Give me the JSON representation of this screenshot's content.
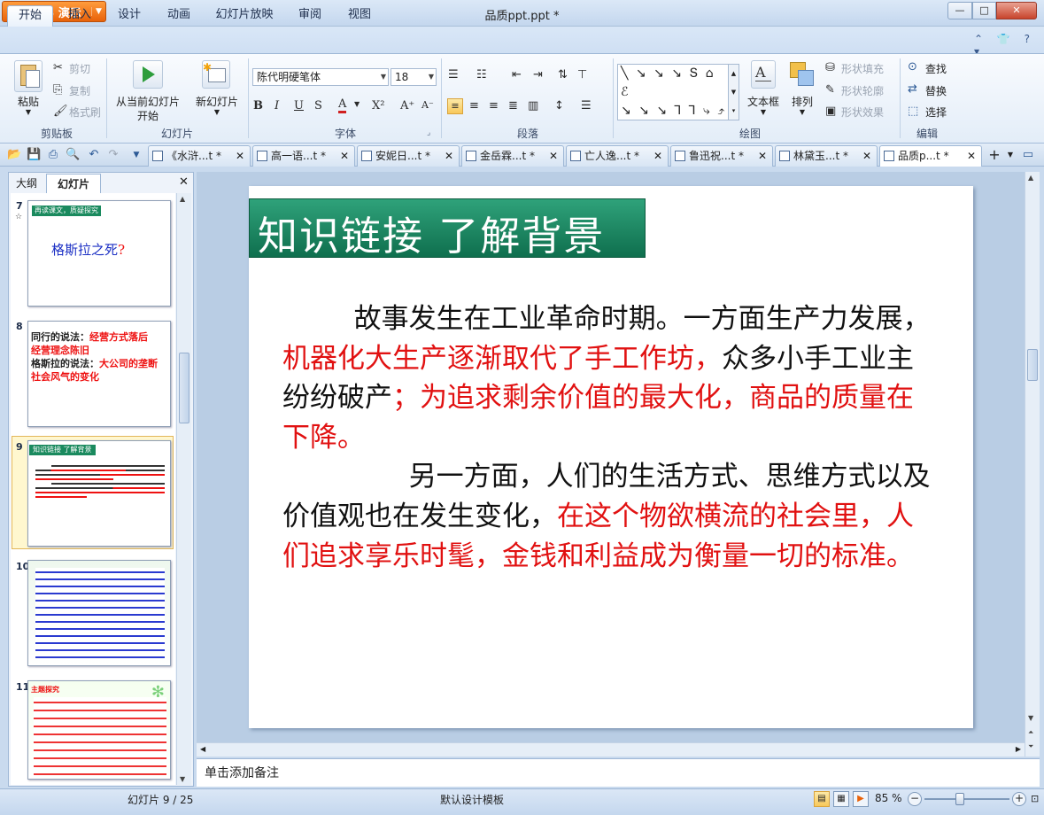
{
  "window": {
    "app_button": "WPS 演示",
    "doc_title": "品质ppt.ppt *",
    "controls": {
      "minimize": "—",
      "maximize": "□",
      "close": "✕"
    }
  },
  "menu": {
    "tabs": [
      "开始",
      "插入",
      "设计",
      "动画",
      "幻灯片放映",
      "审阅",
      "视图"
    ],
    "right_icons": "⌃ 👕 ? ▾"
  },
  "ribbon": {
    "clipboard": {
      "label": "剪贴板",
      "paste": "粘贴",
      "cut": "剪切",
      "copy": "复制",
      "format_painter": "格式刷"
    },
    "slides": {
      "label": "幻灯片",
      "from_current": "从当前幻灯片",
      "from_current_2": "开始",
      "new_slide": "新幻灯片"
    },
    "font": {
      "label": "字体",
      "font_name": "陈代明硬笔体",
      "font_size": "18",
      "bold": "B",
      "italic": "I",
      "underline": "U",
      "shadow": "S",
      "color": "A",
      "superscript": "X²",
      "grow": "A⁺",
      "shrink": "A⁻"
    },
    "paragraph": {
      "label": "段落"
    },
    "drawing": {
      "label": "绘图",
      "textbox": "文本框",
      "arrange": "排列",
      "shape_fill": "形状填充",
      "shape_outline": "形状轮廓",
      "shape_effect": "形状效果"
    },
    "editing": {
      "label": "编辑",
      "find": "查找",
      "replace": "替换",
      "select": "选择"
    }
  },
  "doc_tabs": [
    {
      "label": "《水浒...t *",
      "active": false
    },
    {
      "label": "高一语...t *",
      "active": false
    },
    {
      "label": "安妮日...t *",
      "active": false
    },
    {
      "label": "金岳霖...t *",
      "active": false
    },
    {
      "label": "亡人逸...t *",
      "active": false
    },
    {
      "label": "鲁迅祝...t *",
      "active": false
    },
    {
      "label": "林黛玉...t *",
      "active": false
    },
    {
      "label": "品质p...t *",
      "active": true
    }
  ],
  "left_panel": {
    "tabs": [
      "大纲",
      "幻灯片"
    ],
    "close": "✕",
    "slides": [
      {
        "num": "7",
        "title": "再读课文，质疑探究",
        "text": "格斯拉之死",
        "mark": "?"
      },
      {
        "num": "8",
        "line1a": "同行的说法：",
        "line1b": "经营方式落后",
        "line1c": "经营理念陈旧",
        "line2a": "格斯拉的说法：",
        "line2b": "大公司的垄断",
        "line2c": "社会风气的变化"
      },
      {
        "num": "9",
        "title": "知识链接 了解背景"
      },
      {
        "num": "10"
      },
      {
        "num": "11",
        "title": "主题探究"
      }
    ]
  },
  "slide": {
    "title": "知识链接  了解背景",
    "p1_black1": "故事发生在工业革命时期。一方面生产力发展，",
    "p1_red1": "机器化大生产逐渐取代了手工作坊，",
    "p1_black2": "众多小手工业主纷纷破产",
    "p1_red2": "；为追求剩余价值的最大化，商品的质量在下降。",
    "p2_black": "另一方面，人们的生活方式、思维方式以及价值观也在发生变化，",
    "p2_red": "在这个物欲横流的社会里，人们追求享乐时髦，金钱和利益成为衡量一切的标准。"
  },
  "notes_placeholder": "单击添加备注",
  "status": {
    "slide_count": "幻灯片 9 / 25",
    "template": "默认设计模板",
    "zoom": "85 %"
  }
}
